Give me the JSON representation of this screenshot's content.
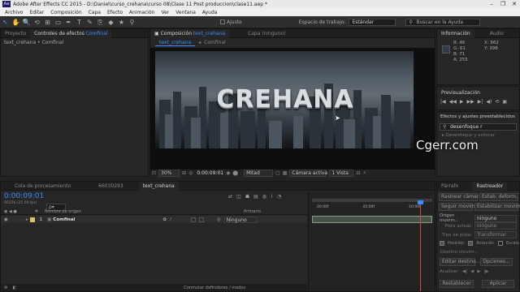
{
  "window": {
    "title": "Adobe After Effects CC 2015 - D:\\Daniel\\curso_crehana\\curso 08\\Clase 11 Post produccion\\clase11.aep *",
    "controls": [
      "–",
      "❐",
      "✕"
    ]
  },
  "menu": [
    "Archivo",
    "Editar",
    "Composición",
    "Capa",
    "Efecto",
    "Animación",
    "Ver",
    "Ventana",
    "Ayuda"
  ],
  "toolbar": {
    "tools": [
      "↖",
      "✋",
      "🔍",
      "⟲",
      "⊞",
      "▭",
      "✒",
      "T",
      "✎",
      "⎘",
      "◆",
      "★",
      "⚲"
    ],
    "snap_label": "Ajuste",
    "workspace_label": "Espacio de trabajo:",
    "workspace_value": "Estándar",
    "help_search_placeholder": "Buscar en la Ayuda"
  },
  "project_panel": {
    "tabs": [
      "Proyecto",
      "Controles de efectos",
      "Comfinal"
    ],
    "breadcrumb": "text_crehana • Comfinal"
  },
  "composition_panel": {
    "tab_label": "Composición",
    "tab_comp": "text_crehana",
    "layer_tab": "Capa (ninguno)",
    "subtabs": [
      "text_crehana",
      "Comfinal"
    ],
    "viewer_text": "CREHANA",
    "footer": {
      "zoom": "30%",
      "timecode": "0:00:09:01",
      "resolution": "Mitad",
      "camera": "Cámara activa",
      "view": "1 Vista"
    }
  },
  "info_panel": {
    "tabs": [
      "Información",
      "Audio"
    ],
    "r_label": "R:",
    "r": "46",
    "g_label": "G:",
    "g": "61",
    "b_label": "B:",
    "b": "71",
    "a_label": "A:",
    "a": "255",
    "x_label": "X:",
    "x": "862",
    "y_label": "Y:",
    "y": "398"
  },
  "preview_panel": {
    "title": "Previsualización",
    "controls": [
      "|◀",
      "◀◀",
      "▶",
      "▶▶",
      "▶|",
      "◀)",
      "⟲",
      "▣"
    ]
  },
  "effects_panel": {
    "title": "Efectos y ajustes preestablecidos",
    "search_value": "desenfoque r",
    "partial_item": "Desenfoque y enfocar"
  },
  "watermark": "Cgerr.com",
  "timeline": {
    "tabs": [
      "Cola de procesamiento",
      "66030293",
      "text_crehana"
    ],
    "timecode": "0:00:09:01",
    "timecode_sub": "00226 (25.00 fps)",
    "search_placeholder": "ρ▾",
    "columns": [
      "#",
      "Nombre de origen",
      "Primario"
    ],
    "layers": [
      {
        "index": "1",
        "name": "Comfinal",
        "parent": "Ninguno"
      }
    ],
    "ruler": [
      "00:00f",
      "05:00f",
      "10:00f"
    ],
    "footer_label": "Conmutar definidores / modos"
  },
  "tracker_panel": {
    "tabs": [
      "Párrafo",
      "Rastreador"
    ],
    "btn_track_camera": "Rastrear cámara",
    "btn_warp_stabilize": "Estab. deform.",
    "btn_track_motion": "Seguir movim.",
    "btn_stabilize_motion": "Estabilizar movim.",
    "motion_source_label": "Origen movim.:",
    "motion_source_value": "ninguno",
    "current_track_label": "Pista actual:",
    "current_track_value": "ninguno",
    "track_type_label": "Tipo de pista:",
    "track_type_value": "Transformar",
    "position_label": "Posición",
    "rotation_label": "Rotación",
    "scale_label": "Escala",
    "motion_target_label": "Destino movim.:",
    "edit_target": "Editar destino...",
    "options": "Opciones...",
    "analyze_label": "Analizar:",
    "analyze_buttons": [
      "◀|",
      "◀",
      "▶",
      "|▶"
    ],
    "reset": "Restablecer",
    "apply": "Aplicar"
  }
}
